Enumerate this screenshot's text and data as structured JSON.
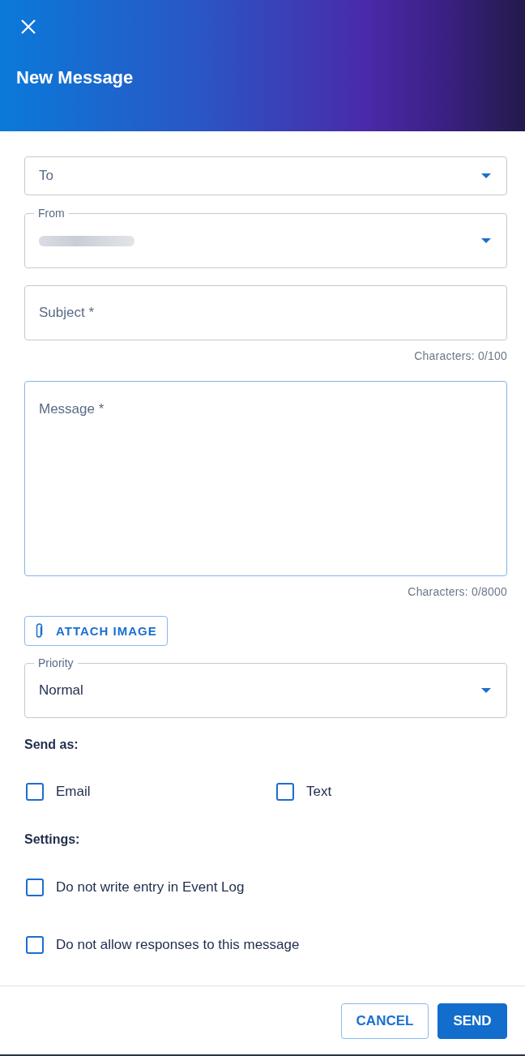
{
  "header": {
    "title": "New Message"
  },
  "fields": [
    {
      "kind": "select",
      "placeholder": "To",
      "focused": false
    },
    {
      "kind": "select",
      "label": "From",
      "value_blurred": true,
      "focused": false
    },
    {
      "kind": "text",
      "placeholder": "Subject *",
      "counter": "Characters: 0/100",
      "focused": false
    },
    {
      "kind": "textarea",
      "placeholder": "Message *",
      "counter": "Characters: 0/8000",
      "focused": true
    }
  ],
  "attach_button": {
    "label": "ATTACH IMAGE"
  },
  "priority_field": {
    "kind": "select",
    "label": "Priority",
    "value": "Normal",
    "focused": false
  },
  "send_as": {
    "heading": "Send as:",
    "options": [
      {
        "label": "Email",
        "checked": false
      },
      {
        "label": "Text",
        "checked": false
      }
    ]
  },
  "settings": {
    "heading": "Settings:",
    "options": [
      {
        "label": "Do not write entry in Event Log",
        "checked": false
      },
      {
        "label": "Do not allow responses to this message",
        "checked": false
      }
    ]
  },
  "footer": {
    "buttons": [
      {
        "label": "CANCEL",
        "kind": "outlined"
      },
      {
        "label": "SEND",
        "kind": "filled"
      }
    ]
  }
}
